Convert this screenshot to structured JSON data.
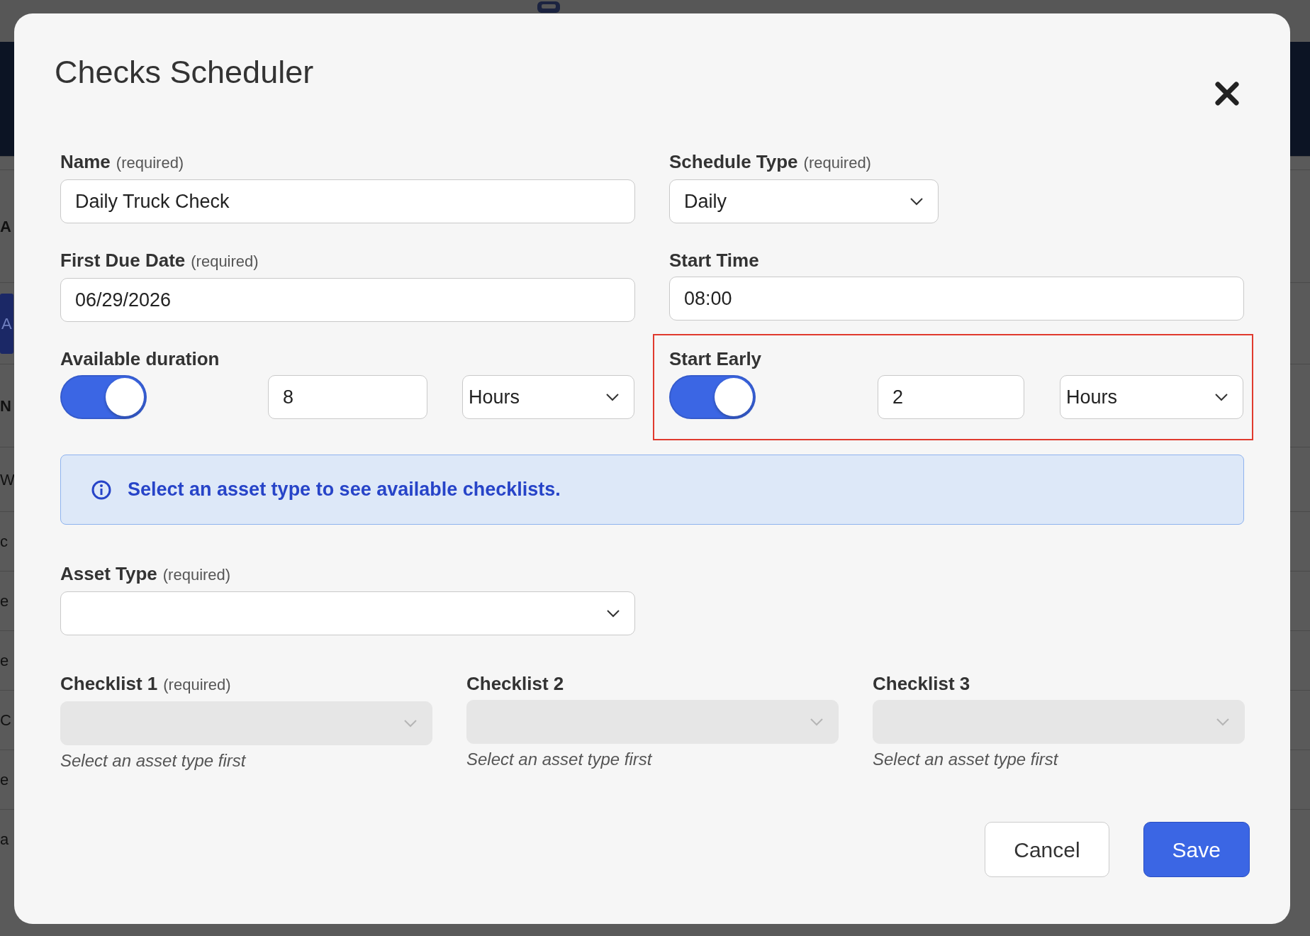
{
  "background": {
    "rows": [
      {
        "text": "A",
        "kind": "heading"
      },
      {
        "text": "A",
        "kind": "button"
      },
      {
        "text": "N",
        "kind": "heading"
      },
      {
        "text": "W",
        "kind": "cell"
      },
      {
        "text": "c",
        "kind": "cell"
      },
      {
        "text": "e",
        "kind": "cell"
      },
      {
        "text": "e",
        "kind": "cell"
      },
      {
        "text": "C",
        "kind": "cell"
      },
      {
        "text": "e",
        "kind": "cell"
      },
      {
        "text": "a",
        "kind": "cell"
      }
    ]
  },
  "dialog": {
    "title": "Checks Scheduler",
    "name": {
      "label": "Name",
      "required_note": "(required)",
      "value": "Daily Truck Check"
    },
    "schedule_type": {
      "label": "Schedule Type",
      "required_note": "(required)",
      "value": "Daily"
    },
    "first_due_date": {
      "label": "First Due Date",
      "required_note": "(required)",
      "value": "06/29/2026"
    },
    "start_time": {
      "label": "Start Time",
      "value": "08:00"
    },
    "available_duration": {
      "label": "Available duration",
      "on": true,
      "amount": "8",
      "unit": "Hours",
      "highlighted": false
    },
    "start_early": {
      "label": "Start Early",
      "on": true,
      "amount": "2",
      "unit": "Hours",
      "highlighted": true
    },
    "alert": {
      "text": "Select an asset type to see available checklists."
    },
    "asset_type": {
      "label": "Asset Type",
      "required_note": "(required)"
    },
    "checklists": [
      {
        "label": "Checklist 1",
        "required_note": "(required)",
        "disabled": true,
        "hint": "Select an asset type first"
      },
      {
        "label": "Checklist 2",
        "disabled": true,
        "hint": "Select an asset type first"
      },
      {
        "label": "Checklist 3",
        "disabled": true,
        "hint": "Select an asset type first"
      }
    ],
    "buttons": [
      {
        "label": "Cancel",
        "kind": "secondary"
      },
      {
        "label": "Save",
        "kind": "primary"
      }
    ]
  }
}
